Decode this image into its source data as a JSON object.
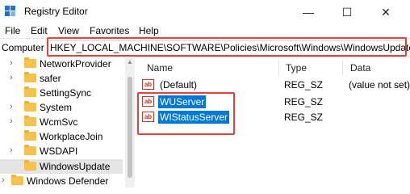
{
  "window": {
    "title": "Registry Editor",
    "minimize": "—",
    "maximize": "☐",
    "close": "✕"
  },
  "menu": [
    "File",
    "Edit",
    "View",
    "Favorites",
    "Help"
  ],
  "address": {
    "label": "Computer",
    "path": "HKEY_LOCAL_MACHINE\\SOFTWARE\\Policies\\Microsoft\\Windows\\WindowsUpdate"
  },
  "tree": {
    "items": [
      {
        "label": "NetworkProvider",
        "expandable": true
      },
      {
        "label": "safer",
        "expandable": true
      },
      {
        "label": "SettingSync",
        "expandable": false
      },
      {
        "label": "System",
        "expandable": true
      },
      {
        "label": "WcmSvc",
        "expandable": true
      },
      {
        "label": "WorkplaceJoin",
        "expandable": false
      },
      {
        "label": "WSDAPI",
        "expandable": true
      },
      {
        "label": "WindowsUpdate",
        "expandable": false,
        "selected": true
      },
      {
        "label": "Windows Defender",
        "expandable": true
      }
    ]
  },
  "list": {
    "columns": [
      "Name",
      "Type",
      "Data"
    ],
    "rows": [
      {
        "icon": "ab",
        "name": "(Default)",
        "type": "REG_SZ",
        "data": "(value not set)",
        "selected": false
      },
      {
        "icon": "ab",
        "name": "WUServer",
        "type": "REG_SZ",
        "data": "",
        "selected": true
      },
      {
        "icon": "ab",
        "name": "WIStatusServer",
        "type": "REG_SZ",
        "data": "",
        "selected": true
      }
    ]
  },
  "colors": {
    "selection": "#0078d7",
    "highlight_box": "#e0443c",
    "folder": "#f4c24d"
  }
}
